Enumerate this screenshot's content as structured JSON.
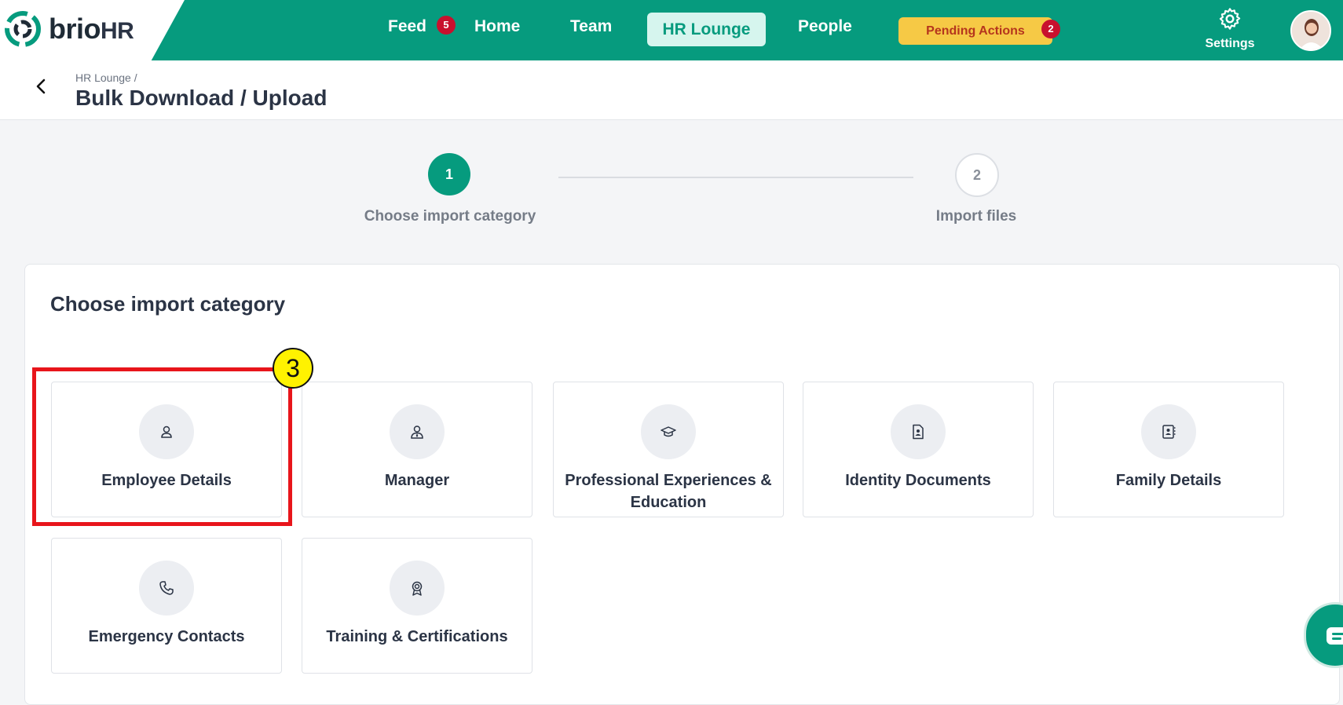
{
  "brand": {
    "name_main": "brio",
    "name_suffix": "HR",
    "accent": "#069b7e"
  },
  "nav": {
    "feed": "Feed",
    "feed_badge": "5",
    "home": "Home",
    "team": "Team",
    "hr_lounge": "HR Lounge",
    "people": "People",
    "pending_actions": "Pending Actions",
    "pending_badge": "2",
    "settings": "Settings"
  },
  "header": {
    "breadcrumb": "HR Lounge  /",
    "title": "Bulk Download / Upload"
  },
  "stepper": {
    "steps": [
      {
        "number": "1",
        "label": "Choose import category",
        "state": "active"
      },
      {
        "number": "2",
        "label": "Import files",
        "state": "pending"
      }
    ]
  },
  "panel": {
    "title": "Choose import category",
    "categories": [
      {
        "label": "Employee Details",
        "icon": "user-icon"
      },
      {
        "label": "Manager",
        "icon": "manager-icon"
      },
      {
        "label": "Professional Experiences & Education",
        "icon": "graduation-cap-icon"
      },
      {
        "label": "Identity Documents",
        "icon": "id-document-icon"
      },
      {
        "label": "Family Details",
        "icon": "contact-book-icon"
      },
      {
        "label": "Emergency Contacts",
        "icon": "phone-icon"
      },
      {
        "label": "Training & Certifications",
        "icon": "award-icon"
      }
    ]
  },
  "annotation": {
    "number": "3"
  }
}
